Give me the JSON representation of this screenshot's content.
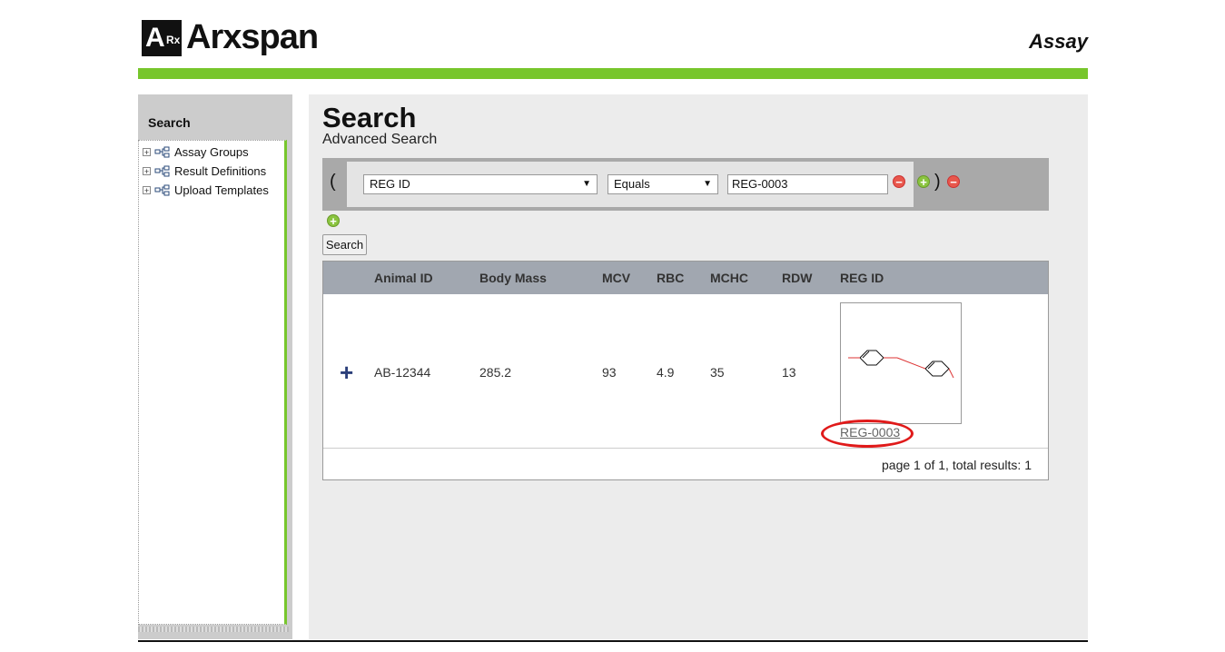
{
  "header": {
    "logo_mark": "A",
    "logo_mark_sub": "Rx",
    "logo_text": "Arxspan",
    "app_name": "Assay"
  },
  "sidebar": {
    "title": "Search",
    "items": [
      {
        "label": "Assay Groups"
      },
      {
        "label": "Result Definitions"
      },
      {
        "label": "Upload Templates"
      }
    ]
  },
  "main": {
    "title": "Search",
    "subtitle": "Advanced Search",
    "query": {
      "open_paren": "(",
      "close_paren": ")",
      "field_value": "REG ID",
      "operator_value": "Equals",
      "input_value": "REG-0003"
    },
    "search_button": "Search",
    "table": {
      "columns": [
        "Animal ID",
        "Body Mass",
        "MCV",
        "RBC",
        "MCHC",
        "RDW",
        "REG ID"
      ],
      "rows": [
        {
          "animal_id": "AB-12344",
          "body_mass": "285.2",
          "mcv": "93",
          "rbc": "4.9",
          "mchc": "35",
          "rdw": "13",
          "reg_id": "REG-0003"
        }
      ]
    },
    "pager": "page 1 of 1, total results: 1"
  },
  "colors": {
    "accent_green": "#77c62c",
    "header_gray": "#a1a7b0",
    "highlight_red": "#e01a1a"
  }
}
